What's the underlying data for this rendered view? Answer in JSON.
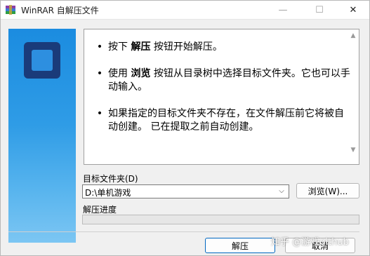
{
  "window": {
    "title": "WinRAR 自解压文件",
    "minimize_glyph": "—",
    "maximize_glyph": "☐",
    "close_glyph": "✕"
  },
  "instructions": [
    {
      "prefix": "按下 ",
      "bold": "解压",
      "suffix": " 按钮开始解压。"
    },
    {
      "prefix": "使用 ",
      "bold": "浏览",
      "suffix": " 按钮从目录树中选择目标文件夹。它也可以手动输入。"
    },
    {
      "prefix": "如果指定的目标文件夹不存在，在文件解压前它将被自动创建。 已在提取之前自动创建。",
      "bold": "",
      "suffix": ""
    }
  ],
  "bullet_glyph": "•",
  "target": {
    "label": "目标文件夹(D)",
    "value": "D:\\单机游戏",
    "browse_label": "浏览(W)..."
  },
  "progress": {
    "label": "解压进度",
    "value": 0
  },
  "buttons": {
    "extract": "解压",
    "cancel": "取消"
  },
  "watermark": "知乎 @游戏github",
  "colors": {
    "accent": "#0067c0",
    "side_panel": "#2f9ce6",
    "logo": "#1a3b7a"
  },
  "icons": {
    "app": "winrar-icon",
    "logo": "sfx-logo-icon"
  }
}
